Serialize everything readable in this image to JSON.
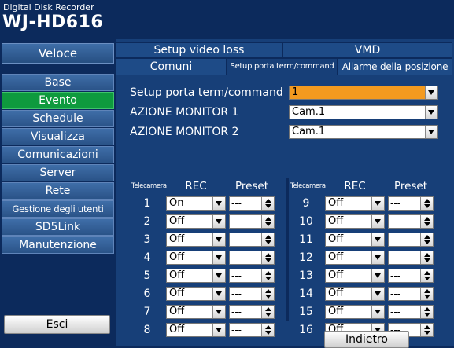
{
  "header": {
    "subtitle": "Digital Disk Recorder",
    "model": "WJ-HD616"
  },
  "sidebar": {
    "top_label": "Veloce",
    "items": [
      "Base",
      "Evento",
      "Schedule",
      "Visualizza",
      "Comunicazioni",
      "Server",
      "Rete",
      "Gestione degli utenti",
      "SD5Link",
      "Manutenzione"
    ],
    "active": "Evento",
    "exit_label": "Esci"
  },
  "tabs": {
    "row1": [
      "Setup video loss",
      "VMD"
    ],
    "row2": [
      "Comuni",
      "Setup porta term/command",
      "Allarme della posizione"
    ],
    "active": "Setup porta term/command"
  },
  "settings": [
    {
      "label": "Setup porta term/command",
      "value": "1",
      "highlight": "#f39a1f"
    },
    {
      "label": "AZIONE MONITOR 1",
      "value": "Cam.1"
    },
    {
      "label": "AZIONE MONITOR 2",
      "value": "Cam.1"
    }
  ],
  "grid": {
    "headers": {
      "camera": "Telecamera",
      "rec": "REC",
      "preset": "Preset"
    },
    "left": [
      {
        "cam": "1",
        "rec": "On",
        "preset": "---"
      },
      {
        "cam": "2",
        "rec": "Off",
        "preset": "---"
      },
      {
        "cam": "3",
        "rec": "Off",
        "preset": "---"
      },
      {
        "cam": "4",
        "rec": "Off",
        "preset": "---"
      },
      {
        "cam": "5",
        "rec": "Off",
        "preset": "---"
      },
      {
        "cam": "6",
        "rec": "Off",
        "preset": "---"
      },
      {
        "cam": "7",
        "rec": "Off",
        "preset": "---"
      },
      {
        "cam": "8",
        "rec": "Off",
        "preset": "---"
      }
    ],
    "right": [
      {
        "cam": "9",
        "rec": "Off",
        "preset": "---"
      },
      {
        "cam": "10",
        "rec": "Off",
        "preset": "---"
      },
      {
        "cam": "11",
        "rec": "Off",
        "preset": "---"
      },
      {
        "cam": "12",
        "rec": "Off",
        "preset": "---"
      },
      {
        "cam": "13",
        "rec": "Off",
        "preset": "---"
      },
      {
        "cam": "14",
        "rec": "Off",
        "preset": "---"
      },
      {
        "cam": "15",
        "rec": "Off",
        "preset": "---"
      },
      {
        "cam": "16",
        "rec": "Off",
        "preset": "---"
      }
    ]
  },
  "back_label": "Indietro",
  "colors": {
    "background": "#0c2a5c",
    "panel": "#173f78",
    "active_nav": "#0e9a3e",
    "highlight": "#f39a1f"
  }
}
